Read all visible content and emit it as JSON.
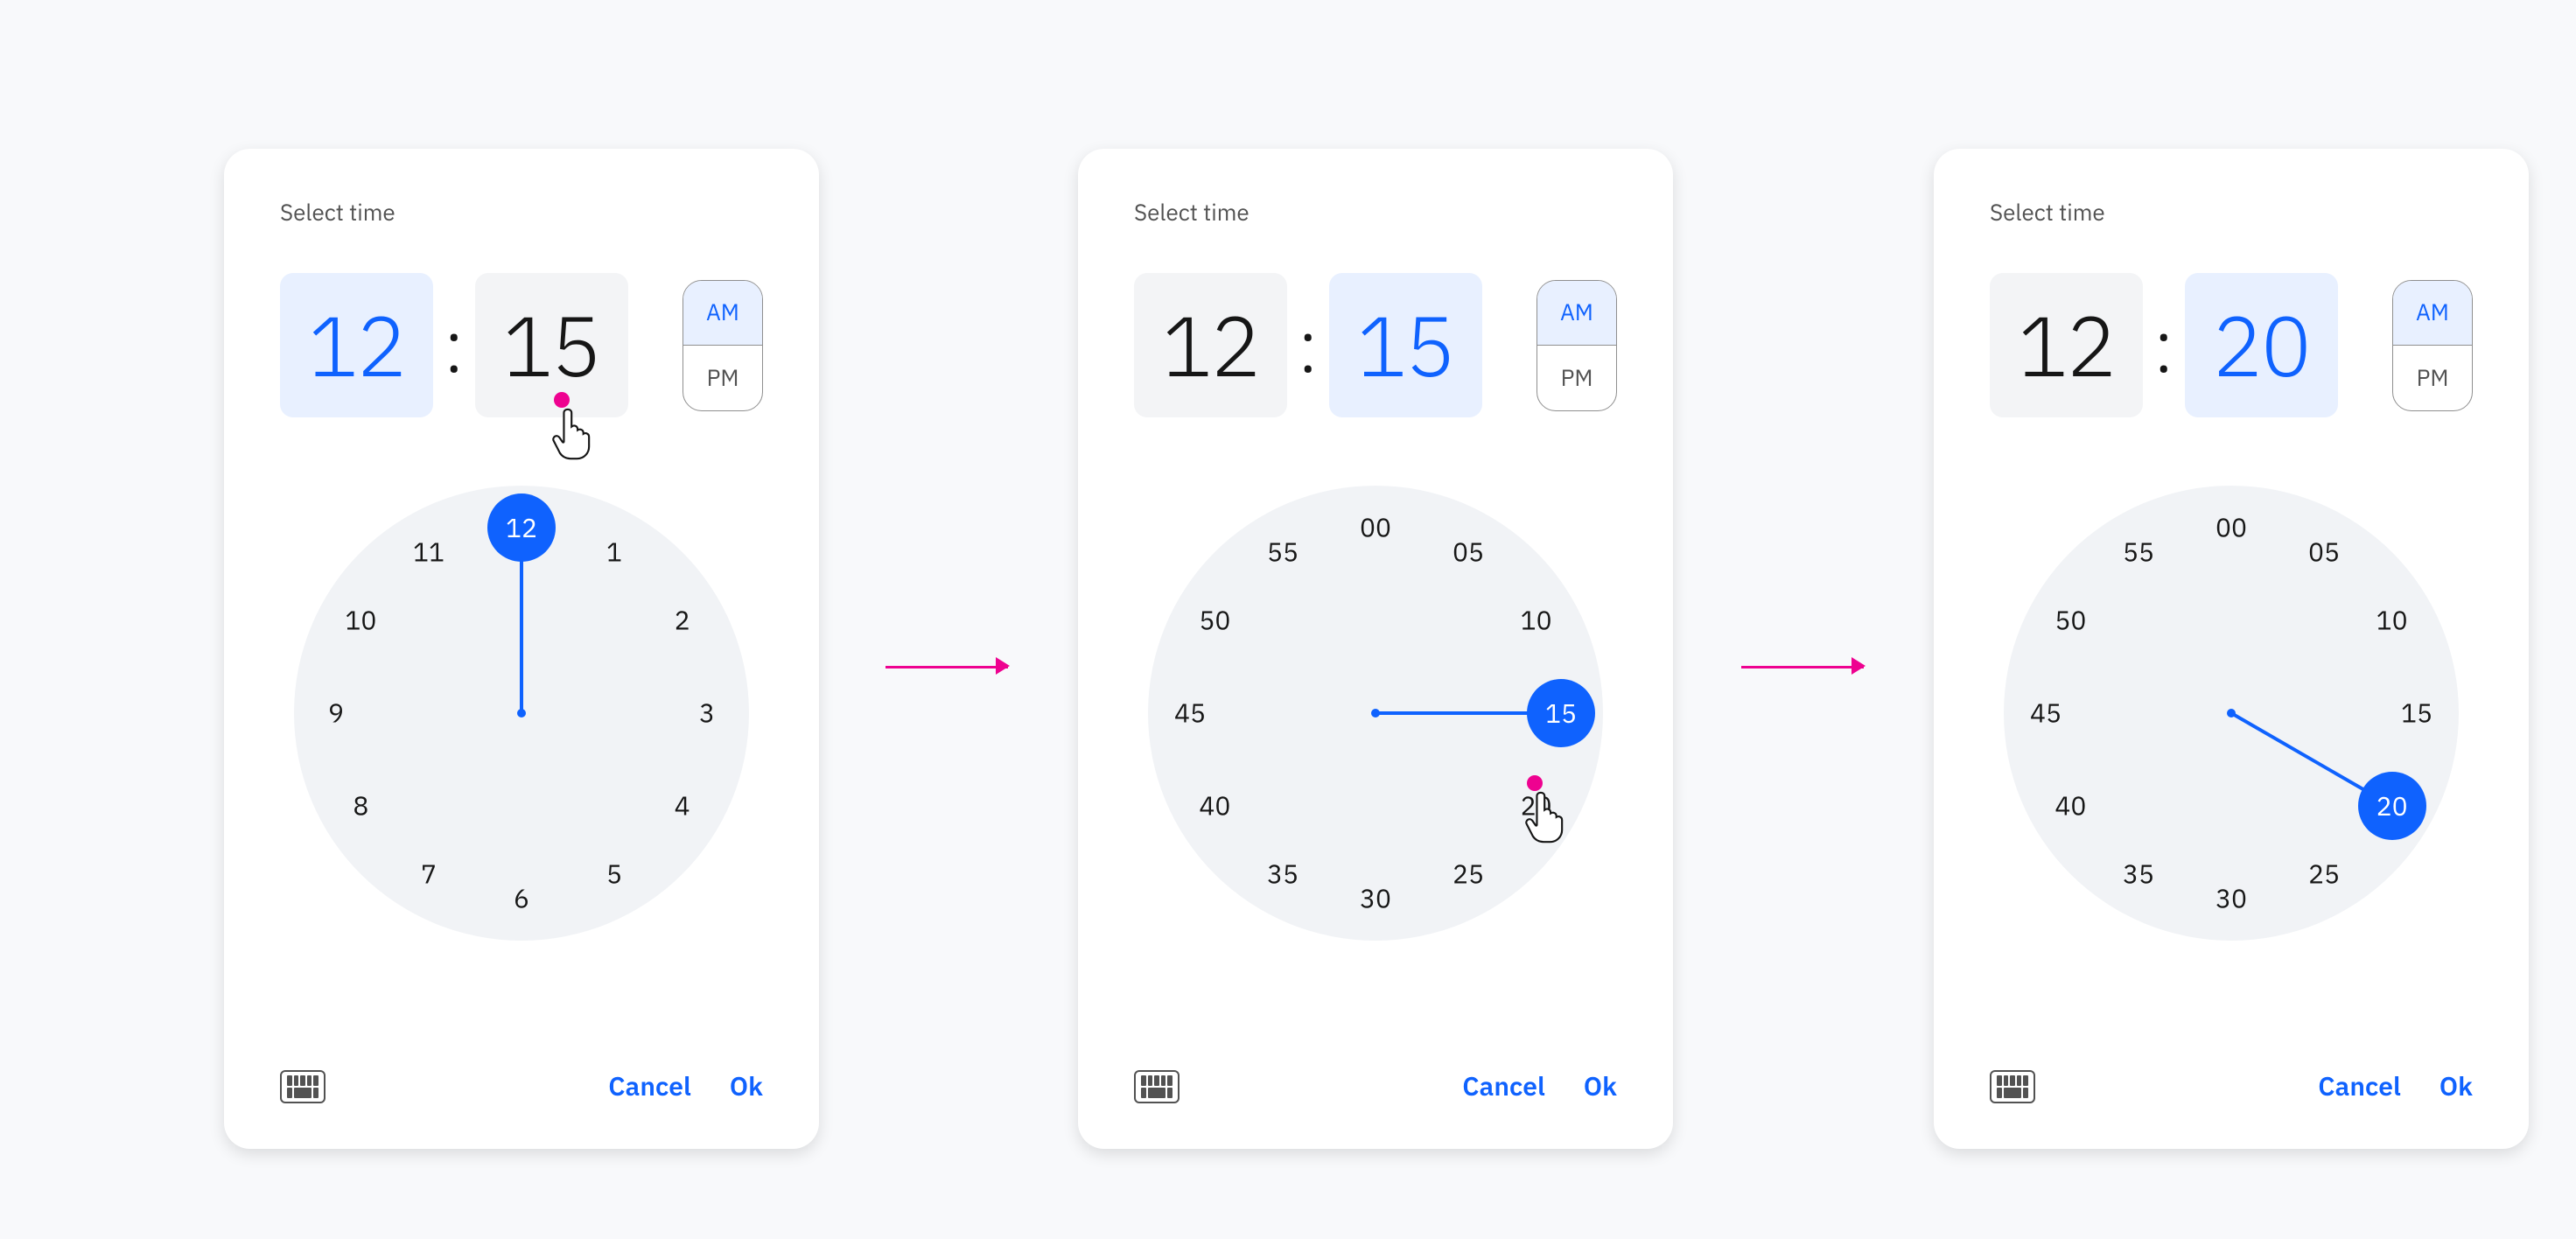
{
  "labels": {
    "title": "Select time",
    "colon": ":",
    "am": "AM",
    "pm": "PM",
    "cancel": "Cancel",
    "ok": "Ok"
  },
  "colors": {
    "primary": "#0f62fe",
    "primaryLight": "#e8f0ff",
    "magenta": "#ee0290"
  },
  "pickers": [
    {
      "hour": "12",
      "minute": "15",
      "hourActive": true,
      "minuteActive": false,
      "ampmSelected": "AM",
      "clockMode": "hours",
      "clockLabels": [
        "12",
        "1",
        "2",
        "3",
        "4",
        "5",
        "6",
        "7",
        "8",
        "9",
        "10",
        "11"
      ],
      "handAngleDeg": 0,
      "knobLabel": "12",
      "cursorAtKnob": false,
      "cursorAtMinuteBox": true
    },
    {
      "hour": "12",
      "minute": "15",
      "hourActive": false,
      "minuteActive": true,
      "ampmSelected": "AM",
      "clockMode": "minutes",
      "clockLabels": [
        "00",
        "05",
        "10",
        "15",
        "20",
        "25",
        "30",
        "35",
        "40",
        "45",
        "50",
        "55"
      ],
      "handAngleDeg": 90,
      "knobLabel": "15",
      "cursorAtKnob": true,
      "cursorAtMinuteBox": false,
      "cursorAtMinute": "20"
    },
    {
      "hour": "12",
      "minute": "20",
      "hourActive": false,
      "minuteActive": true,
      "ampmSelected": "AM",
      "clockMode": "minutes",
      "clockLabels": [
        "00",
        "05",
        "10",
        "15",
        "20",
        "25",
        "30",
        "35",
        "40",
        "45",
        "50",
        "55"
      ],
      "handAngleDeg": 120,
      "knobLabel": "20",
      "cursorAtKnob": false,
      "cursorAtMinuteBox": false
    }
  ]
}
